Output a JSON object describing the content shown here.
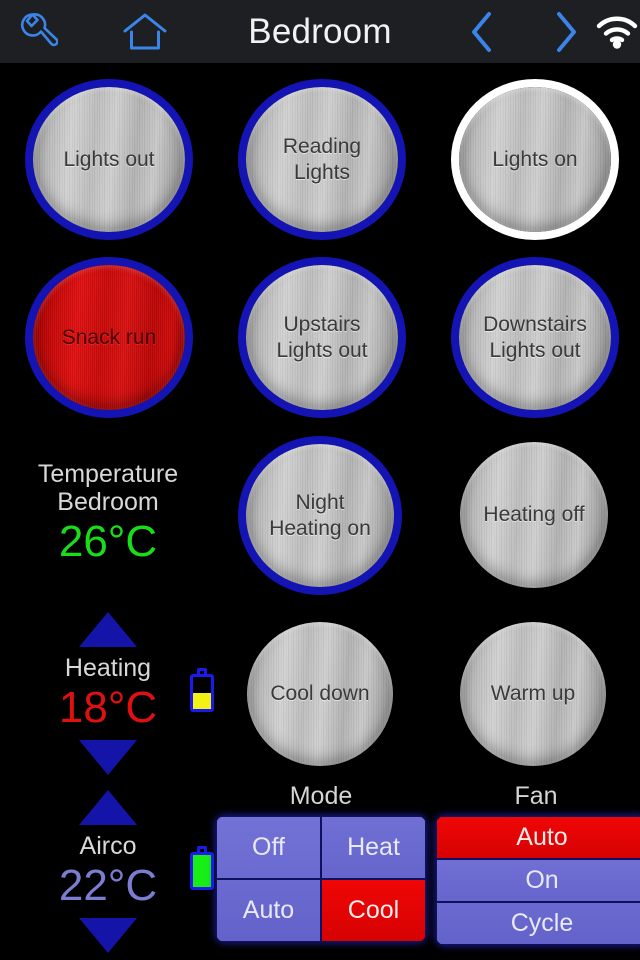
{
  "header": {
    "title": "Bedroom",
    "icons": [
      {
        "name": "settings-wrench-icon",
        "label": "Settings"
      },
      {
        "name": "home-icon",
        "label": "Home"
      },
      {
        "name": "prev-chevron-icon",
        "label": "Previous"
      },
      {
        "name": "next-chevron-icon",
        "label": "Next"
      },
      {
        "name": "wifi-icon",
        "label": "WiFi connected"
      }
    ],
    "accent_blue": "#3b84e8",
    "bar_color": "#1d1f22",
    "title_color": "#f2f2f2"
  },
  "scene_buttons": [
    {
      "label": "Lights out",
      "state": "metal",
      "ring": "blue"
    },
    {
      "label": "Reading\nLights",
      "state": "metal",
      "ring": "blue"
    },
    {
      "label": "Lights on",
      "state": "metal",
      "ring": "white"
    },
    {
      "label": "Snack run",
      "state": "red",
      "ring": "blue"
    },
    {
      "label": "Upstairs\nLights out",
      "state": "metal",
      "ring": "blue"
    },
    {
      "label": "Downstairs\nLights out",
      "state": "metal",
      "ring": "blue"
    },
    {
      "label": "Night\nHeating on",
      "state": "metal",
      "ring": "blue"
    },
    {
      "label": "Heating off",
      "state": "metal",
      "ring": "none"
    },
    {
      "label": "Cool down",
      "state": "metal",
      "ring": "none"
    },
    {
      "label": "Warm up",
      "state": "metal",
      "ring": "none"
    }
  ],
  "readouts": {
    "temperature": {
      "title": "Temperature\nBedroom",
      "value": "26°C",
      "color": "#19dd19"
    },
    "heating": {
      "title": "Heating",
      "value": "18°C",
      "color": "#e01010",
      "up_label": "Increase heating setpoint",
      "down_label": "Decrease heating setpoint",
      "battery": {
        "level_percent": 50,
        "fill_color": "#f2f215"
      }
    },
    "airco": {
      "title": "Airco",
      "value": "22°C",
      "color": "#7c7cd0",
      "up_label": "Increase airco setpoint",
      "down_label": "Decrease airco setpoint",
      "battery": {
        "level_percent": 100,
        "fill_color": "#16ee16"
      }
    }
  },
  "mode_panel": {
    "title": "Mode",
    "options": [
      {
        "label": "Off",
        "active": false
      },
      {
        "label": "Heat",
        "active": false
      },
      {
        "label": "Auto",
        "active": false
      },
      {
        "label": "Cool",
        "active": true
      }
    ],
    "selected": "Cool"
  },
  "fan_panel": {
    "title": "Fan",
    "options": [
      {
        "label": "Auto",
        "active": true
      },
      {
        "label": "On",
        "active": false
      },
      {
        "label": "Cycle",
        "active": false
      }
    ],
    "selected": "Auto"
  },
  "theme": {
    "background": "#000000",
    "ring_blue": "#1414b4",
    "ring_white": "#ffffff",
    "active_red": "#e01010",
    "segment_violet": "#6f6fd4"
  }
}
